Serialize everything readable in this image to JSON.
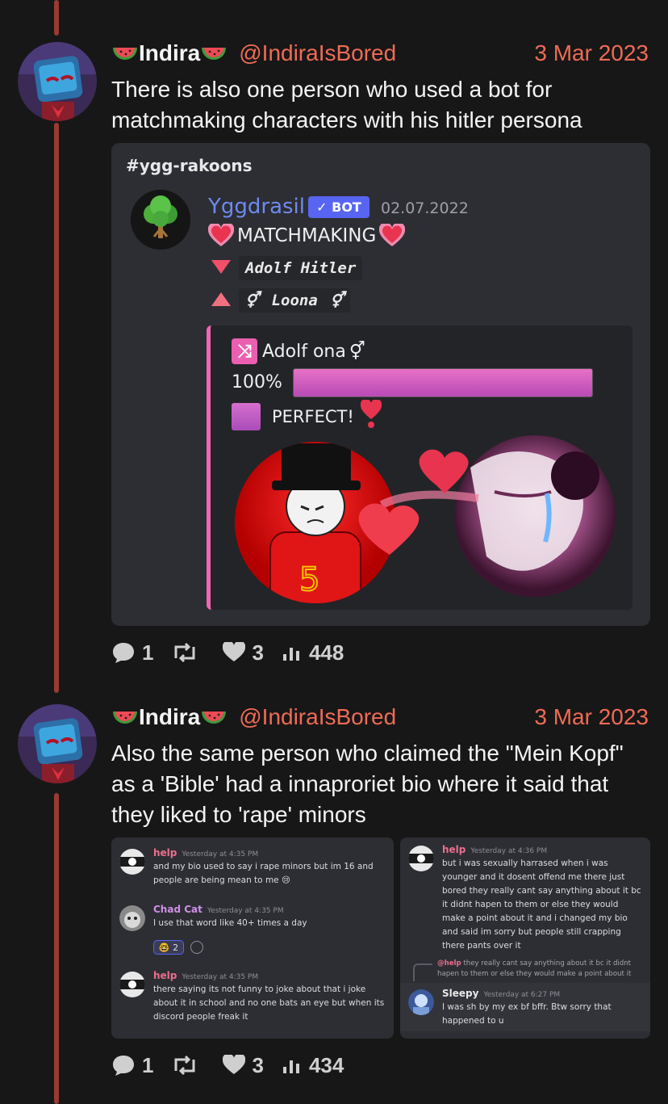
{
  "posts": [
    {
      "display_name": "Indira",
      "handle": "@IndiraIsBored",
      "date": "3 Mar 2023",
      "text": "There is also one person who used a bot for matchmaking characters with his hitler persona",
      "stats": {
        "replies": "1",
        "retweets": "",
        "likes": "3",
        "views": "448"
      },
      "attachment": {
        "channel": "#ygg-rakoons",
        "bot_name": "Yggdrasil",
        "bot_badge": "✓ BOT",
        "bot_date": "02.07.2022",
        "title": "MATCHMAKING",
        "down_row": "Adolf Hitler",
        "up_row": "Loona",
        "gender_glyph": "⚥",
        "embed_title": "Adolf ona",
        "percent_label": "100%",
        "percent_value": 1.0,
        "verdict": "PERFECT!",
        "shirt_number": "5"
      }
    },
    {
      "display_name": "Indira",
      "handle": "@IndiraIsBored",
      "date": "3 Mar 2023",
      "text": "Also the same person who claimed the \"Mein Kopf\" as a 'Bible' had a innaproriet bio where it said that they liked to 'rape' minors",
      "stats": {
        "replies": "1",
        "retweets": "",
        "likes": "3",
        "views": "434"
      },
      "screenshot_left": [
        {
          "user": "help",
          "time": "Yesterday at 4:35 PM",
          "text": "and my bio used to say i rape minors but im 16 and people are being mean to me 😢"
        },
        {
          "user": "Chad Cat",
          "time": "Yesterday at 4:35 PM",
          "text": "I use that word like 40+ times a day",
          "reaction": "🤓 2"
        },
        {
          "user": "help",
          "time": "Yesterday at 4:35 PM",
          "text": "there saying its not funny to joke about that i joke about it in school and no one bats an eye but when its discord people freak it"
        }
      ],
      "screenshot_right": [
        {
          "user": "help",
          "time": "Yesterday at 4:36 PM",
          "text": "but i was sexually harrased when i was younger and it dosent offend me there just bored they really cant say anything about it bc it didnt hapen to them or else they would make a point about it and i changed my bio and said im sorry but people still crapping there pants over it"
        },
        {
          "reply_user": "@help",
          "reply_text": "they really cant say anything about it bc it didnt hapen to them or else they would make a point about it"
        },
        {
          "user": "Sleepy",
          "time": "Yesterday at 6:27 PM",
          "text": "I was sh by my ex bf bffr. Btw sorry that happened to u"
        }
      ]
    }
  ],
  "colors": {
    "accent": "#ef6b55",
    "thread": "#9a3a33",
    "discord_bg": "#2d2e33",
    "bot_blue": "#5865f2"
  },
  "icons": [
    "watermelon-icon",
    "reply-icon",
    "retweet-icon",
    "heart-icon",
    "views-icon",
    "shuffle-icon"
  ]
}
